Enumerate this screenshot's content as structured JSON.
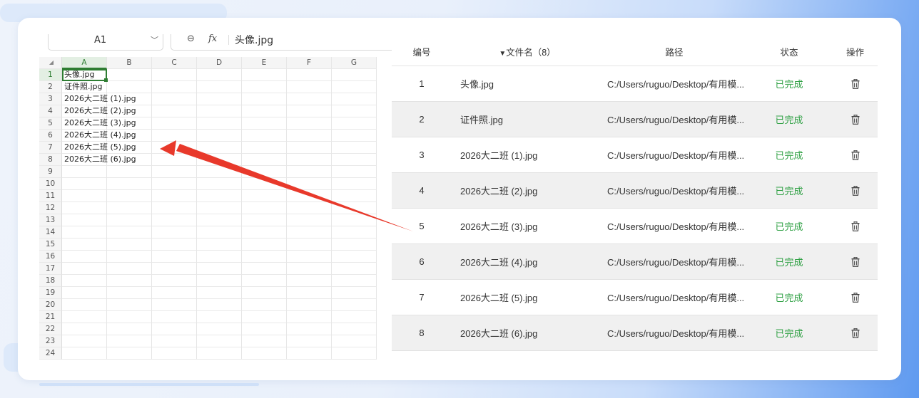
{
  "spreadsheet": {
    "name_box": "A1",
    "formula_value": "头像.jpg",
    "columns": [
      "A",
      "B",
      "C",
      "D",
      "E",
      "F",
      "G"
    ],
    "row_numbers": [
      "1",
      "2",
      "3",
      "4",
      "5",
      "6",
      "7",
      "8",
      "9",
      "10",
      "11",
      "12",
      "13",
      "14",
      "15",
      "16",
      "17",
      "18",
      "19",
      "20",
      "21",
      "22",
      "23",
      "24"
    ],
    "cells_a": [
      "头像.jpg",
      "证件照.jpg",
      "2026大二班 (1).jpg",
      "2026大二班 (2).jpg",
      "2026大二班 (3).jpg",
      "2026大二班 (4).jpg",
      "2026大二班 (5).jpg",
      "2026大二班 (6).jpg"
    ]
  },
  "file_table": {
    "headers": {
      "number": "编号",
      "filename": "文件名（8）",
      "path": "路径",
      "status": "状态",
      "action": "操作"
    },
    "rows": [
      {
        "num": "1",
        "name": "头像.jpg",
        "path": "C:/Users/ruguo/Desktop/有用模...",
        "status": "已完成"
      },
      {
        "num": "2",
        "name": "证件照.jpg",
        "path": "C:/Users/ruguo/Desktop/有用模...",
        "status": "已完成"
      },
      {
        "num": "3",
        "name": "2026大二班 (1).jpg",
        "path": "C:/Users/ruguo/Desktop/有用模...",
        "status": "已完成"
      },
      {
        "num": "4",
        "name": "2026大二班 (2).jpg",
        "path": "C:/Users/ruguo/Desktop/有用模...",
        "status": "已完成"
      },
      {
        "num": "5",
        "name": "2026大二班 (3).jpg",
        "path": "C:/Users/ruguo/Desktop/有用模...",
        "status": "已完成"
      },
      {
        "num": "6",
        "name": "2026大二班 (4).jpg",
        "path": "C:/Users/ruguo/Desktop/有用模...",
        "status": "已完成"
      },
      {
        "num": "7",
        "name": "2026大二班 (5).jpg",
        "path": "C:/Users/ruguo/Desktop/有用模...",
        "status": "已完成"
      },
      {
        "num": "8",
        "name": "2026大二班 (6).jpg",
        "path": "C:/Users/ruguo/Desktop/有用模...",
        "status": "已完成"
      }
    ]
  },
  "colors": {
    "status_done": "#2ea043",
    "active_cell": "#2e7d32",
    "arrow": "#e8392b"
  },
  "icons": {
    "action": "trash-icon",
    "name_dropdown": "chevron-down-icon",
    "formula_zoom": "zoom-icon",
    "formula_fx": "fx-icon"
  }
}
